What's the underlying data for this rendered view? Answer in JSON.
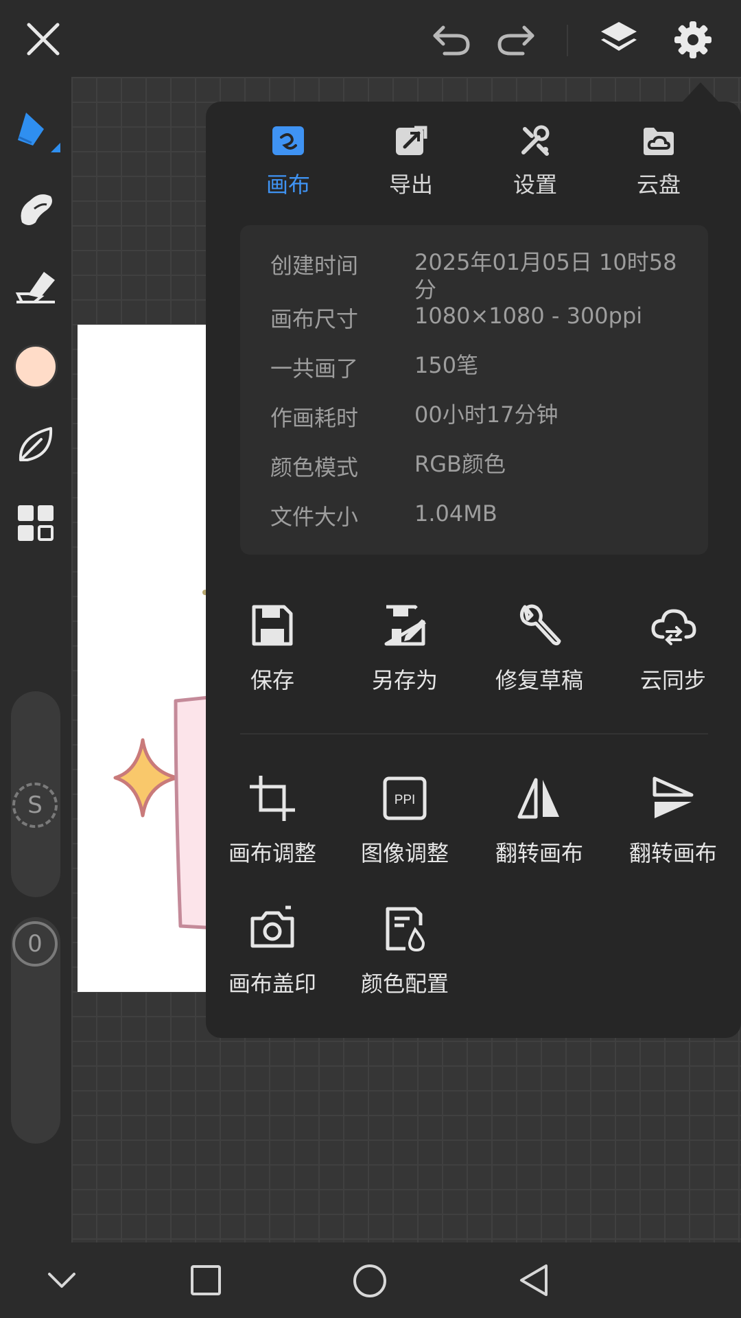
{
  "toolbar": {
    "close_icon": "close-icon",
    "undo_icon": "undo-icon",
    "redo_icon": "redo-icon",
    "layers_icon": "layers-icon",
    "settings_icon": "gear-icon"
  },
  "left_tools": [
    {
      "name": "pen",
      "icon": "pen-icon",
      "active": true
    },
    {
      "name": "smudge",
      "icon": "smudge-icon"
    },
    {
      "name": "eraser",
      "icon": "eraser-icon"
    },
    {
      "name": "color",
      "icon": "color-swatch",
      "color": "#ffdcc8"
    },
    {
      "name": "material",
      "icon": "leaf-icon"
    },
    {
      "name": "more",
      "icon": "grid-icon"
    }
  ],
  "sliders": {
    "size_label": "S",
    "opacity_label": "0"
  },
  "panel": {
    "tabs": [
      {
        "label": "画布",
        "icon": "canvas-tab-icon",
        "active": true
      },
      {
        "label": "导出",
        "icon": "export-icon"
      },
      {
        "label": "设置",
        "icon": "tools-icon"
      },
      {
        "label": "云盘",
        "icon": "cloud-folder-icon"
      }
    ],
    "info": [
      {
        "key": "创建时间",
        "value": "2025年01月05日 10时58分"
      },
      {
        "key": "画布尺寸",
        "value": "1080×1080 - 300ppi"
      },
      {
        "key": "一共画了",
        "value": "150笔"
      },
      {
        "key": "作画耗时",
        "value": "00小时17分钟"
      },
      {
        "key": "颜色模式",
        "value": "RGB颜色"
      },
      {
        "key": "文件大小",
        "value": "1.04MB"
      }
    ],
    "actions_top": [
      {
        "label": "保存",
        "icon": "save-icon"
      },
      {
        "label": "另存为",
        "icon": "save-as-icon"
      },
      {
        "label": "修复草稿",
        "icon": "wrench-icon"
      },
      {
        "label": "云同步",
        "icon": "cloud-sync-icon"
      }
    ],
    "actions_bottom": [
      {
        "label": "画布调整",
        "icon": "crop-icon"
      },
      {
        "label": "图像调整",
        "icon": "ppi-icon",
        "badge": "PPI"
      },
      {
        "label": "翻转画布",
        "icon": "flip-horizontal-icon"
      },
      {
        "label": "翻转画布",
        "icon": "flip-vertical-icon"
      },
      {
        "label": "画布盖印",
        "icon": "camera-icon"
      },
      {
        "label": "颜色配置",
        "icon": "color-profile-icon"
      }
    ]
  },
  "navbar": {
    "hide_icon": "chevron-down-icon",
    "recents_icon": "square-icon",
    "home_icon": "circle-icon",
    "back_icon": "triangle-back-icon"
  },
  "colors": {
    "accent": "#3f93f3",
    "panel_bg": "#262626",
    "info_bg": "#2e2e2e",
    "swatch": "#ffdcc8",
    "sparkle": "#f9c86b",
    "pink_shape": "#fce4ea"
  }
}
